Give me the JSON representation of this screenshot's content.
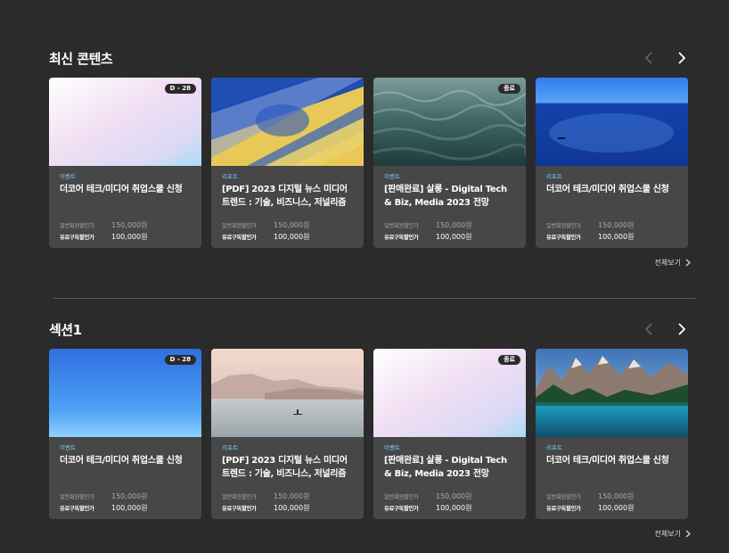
{
  "sections": [
    {
      "title": "최신 콘텐츠",
      "view_all": "전체보기",
      "cards": [
        {
          "category": "이벤트",
          "title": "더코어 테크/미디어 취업스쿨 신청",
          "badge": "D - 28",
          "thumb": "pastel-gradient",
          "prices": [
            {
              "label": "일반회원할인가",
              "value": "150,000원"
            },
            {
              "label": "유료구독할인가",
              "value": "100,000원"
            }
          ]
        },
        {
          "category": "리포트",
          "title": "[PDF] 2023 디지털 뉴스 미디어 트렌드 : 기술, 비즈니스, 저널리즘",
          "badge": "",
          "thumb": "blue-yellow-abstract",
          "prices": [
            {
              "label": "일반회원할인가",
              "value": "150,000원"
            },
            {
              "label": "유료구독할인가",
              "value": "100,000원"
            }
          ]
        },
        {
          "category": "이벤트",
          "title": "[판매완료] 살롱 - Digital Tech & Biz, Media 2023 전망",
          "badge": "종료",
          "thumb": "ocean-waves",
          "prices": [
            {
              "label": "일반회원할인가",
              "value": "150,000원"
            },
            {
              "label": "유료구독할인가",
              "value": "100,000원"
            }
          ]
        },
        {
          "category": "리포트",
          "title": "더코어 테크/미디어 취업스쿨 신청",
          "badge": "",
          "thumb": "blue-sea-sparkle",
          "prices": [
            {
              "label": "일반회원할인가",
              "value": "150,000원"
            },
            {
              "label": "유료구독할인가",
              "value": "100,000원"
            }
          ]
        }
      ]
    },
    {
      "title": "섹션1",
      "view_all": "전체보기",
      "cards": [
        {
          "category": "이벤트",
          "title": "더코어 테크/미디어 취업스쿨 신청",
          "badge": "D - 28",
          "thumb": "blue-sky-gradient",
          "prices": [
            {
              "label": "일반회원할인가",
              "value": "150,000원"
            },
            {
              "label": "유료구독할인가",
              "value": "100,000원"
            }
          ]
        },
        {
          "category": "리포트",
          "title": "[PDF] 2023 디지털 뉴스 미디어 트렌드 : 기술, 비즈니스, 저널리즘",
          "badge": "",
          "thumb": "misty-lake-paddler",
          "prices": [
            {
              "label": "일반회원할인가",
              "value": "150,000원"
            },
            {
              "label": "유료구독할인가",
              "value": "100,000원"
            }
          ]
        },
        {
          "category": "이벤트",
          "title": "[판매완료] 살롱 - Digital Tech & Biz, Media 2023 전망",
          "badge": "종료",
          "thumb": "pastel-gradient-2",
          "prices": [
            {
              "label": "일반회원할인가",
              "value": "150,000원"
            },
            {
              "label": "유료구독할인가",
              "value": "100,000원"
            }
          ]
        },
        {
          "category": "리포트",
          "title": "더코어 테크/미디어 취업스쿨 신청",
          "badge": "",
          "thumb": "mountain-lake",
          "prices": [
            {
              "label": "일반회원할인가",
              "value": "150,000원"
            },
            {
              "label": "유료구독할인가",
              "value": "100,000원"
            }
          ]
        }
      ]
    }
  ],
  "icons": {
    "prev": "chevron-left-icon",
    "next": "chevron-right-icon",
    "view_all": "chevron-right-small-icon"
  },
  "colors": {
    "background": "#2b2b2b",
    "card": "#474747",
    "category": "#7fd0ff",
    "badge": "#2b2b2b"
  }
}
